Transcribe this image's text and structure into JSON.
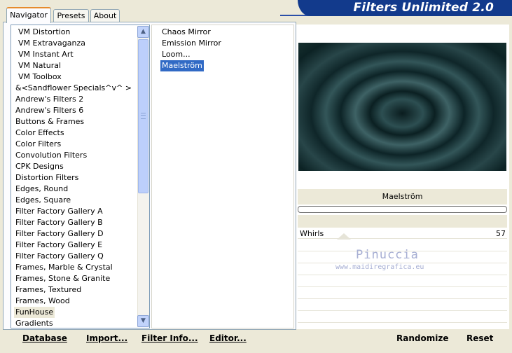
{
  "banner": {
    "title": "Filters Unlimited 2.0"
  },
  "tabs": [
    {
      "label": "Navigator",
      "active": true
    },
    {
      "label": "Presets",
      "active": false
    },
    {
      "label": "About",
      "active": false
    }
  ],
  "categories": [
    "VM Distortion",
    "VM Extravaganza",
    "VM Instant Art",
    "VM Natural",
    "VM Toolbox",
    "&<Sandflower Specials^v^ >",
    "Andrew's Filters 2",
    "Andrew's Filters 6",
    "Buttons & Frames",
    "Color Effects",
    "Color Filters",
    "Convolution Filters",
    "CPK Designs",
    "Distortion Filters",
    "Edges, Round",
    "Edges, Square",
    "Filter Factory Gallery A",
    "Filter Factory Gallery B",
    "Filter Factory Gallery D",
    "Filter Factory Gallery E",
    "Filter Factory Gallery Q",
    "Frames, Marble & Crystal",
    "Frames, Stone & Granite",
    "Frames, Textured",
    "Frames, Wood",
    "FunHouse",
    "Gradients"
  ],
  "selected_category": "FunHouse",
  "filters": [
    "Chaos Mirror",
    "Emission Mirror",
    "Loom...",
    "Maelström"
  ],
  "selected_filter": "Maelström",
  "preview": {
    "filter_name": "Maelström"
  },
  "slider": {
    "label": "Whirls",
    "value": "57",
    "max": 255
  },
  "watermark": {
    "line1": "Pinuccia",
    "line2": "www.maidiregrafica.eu"
  },
  "buttons": {
    "database": "Database",
    "import": "Import...",
    "filter_info": "Filter Info...",
    "editor": "Editor...",
    "randomize": "Randomize",
    "reset": "Reset"
  },
  "colors": {
    "banner": "#123a8c",
    "selection": "#316ac5",
    "active_tab_accent": "#e68b2c"
  }
}
